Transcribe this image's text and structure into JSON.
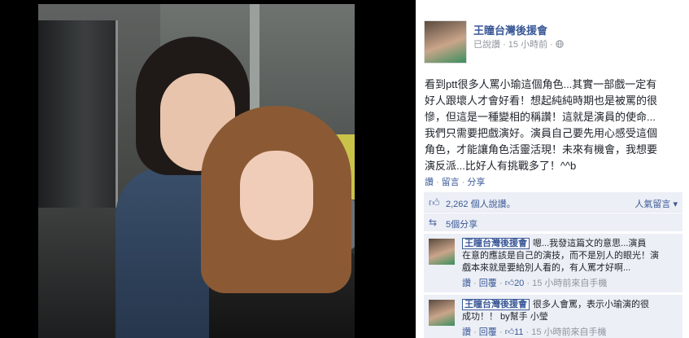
{
  "post": {
    "page_name": "王瞳台灣後援會",
    "meta_prefix": "已說讚",
    "meta_sep": "·",
    "time": "15 小時前",
    "time_sep": "·",
    "text_lines": [
      "看到ptt很多人罵小瑜這個角色...其實一部戲一定有",
      "好人跟壞人才會好看！想起純純時期也是被罵的很",
      "慘，但這是一種變相的稱讚！這就是演員的使命...",
      "我們只需要把戲演好。演員自己要先用心感受這個",
      "角色，才能讓角色活靈活現！未來有機會，我想要",
      "演反派...比好人有挑戰多了！^^b"
    ],
    "actions": {
      "like": "讚",
      "comment": "留言",
      "share": "分享",
      "sep": "·"
    },
    "likes": {
      "count_text": "2,262 個人說讚。",
      "right_text": "人氣留言"
    },
    "shares": {
      "label": "5個分享"
    }
  },
  "comments": [
    {
      "author": "王瞳台灣後援會",
      "lines": [
        "嗯...我發這篇文的意思...演員",
        "在意的應該是自己的演技，而不是別人的眼光！演",
        "戲本來就是要給別人看的，有人罵才好啊..."
      ],
      "like": "讚",
      "reply": "回覆",
      "likes_count": "20",
      "time": "15 小時前來自手機"
    },
    {
      "author": "王瞳台灣後援會",
      "lines": [
        "很多人會罵，表示小瑜演的很",
        "成功！！ by幫手 小瑩"
      ],
      "like": "讚",
      "reply": "回覆",
      "likes_count": "11",
      "time": "15 小時前來自手機"
    }
  ],
  "icons": {
    "like": "thumbs-up-icon",
    "share": "share-icon",
    "globe": "globe-icon"
  },
  "colors": {
    "link": "#3b5998",
    "meta": "#90949c",
    "ufi_bg": "#eceff5"
  }
}
